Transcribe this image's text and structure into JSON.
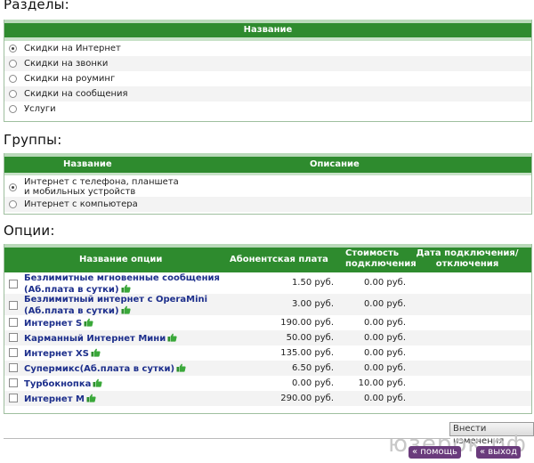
{
  "sections": {
    "heading": "Разделы:",
    "column": "Название",
    "items": [
      {
        "label": "Скидки на Интернет",
        "selected": true
      },
      {
        "label": "Скидки на звонки",
        "selected": false
      },
      {
        "label": "Скидки на роуминг",
        "selected": false
      },
      {
        "label": "Скидки на сообщения",
        "selected": false
      },
      {
        "label": "Услуги",
        "selected": false
      }
    ]
  },
  "groups": {
    "heading": "Группы:",
    "columns": [
      "Название",
      "Описание"
    ],
    "items": [
      {
        "label_line1": "Интернет с телефона, планшета",
        "label_line2": "и мобильных устройств",
        "selected": true
      },
      {
        "label_line1": "Интернет с компьютера",
        "label_line2": "",
        "selected": false
      }
    ]
  },
  "options": {
    "heading": "Опции:",
    "columns": {
      "name": "Название опции",
      "fee": "Абонентская плата",
      "cost_line1": "Стоимость",
      "cost_line2": "подключения",
      "date_line1": "Дата подключения/",
      "date_line2": "отключения"
    },
    "rows": [
      {
        "line1": "Безлимитные мгновенные сообщения",
        "line2": "(Аб.плата в сутки)",
        "fee": "1.50 руб.",
        "cost": "0.00 руб."
      },
      {
        "line1": "Безлимитный интернет с OperaMini",
        "line2": "(Аб.плата в сутки)",
        "fee": "3.00 руб.",
        "cost": "0.00 руб."
      },
      {
        "line1": "Интернет S",
        "line2": "",
        "fee": "190.00 руб.",
        "cost": "0.00 руб."
      },
      {
        "line1": "Карманный Интернет Мини",
        "line2": "",
        "fee": "50.00 руб.",
        "cost": "0.00 руб."
      },
      {
        "line1": "Интернет XS",
        "line2": "",
        "fee": "135.00 руб.",
        "cost": "0.00 руб."
      },
      {
        "line1": "Супермикс(Аб.плата в сутки)",
        "line2": "",
        "fee": "6.50 руб.",
        "cost": "0.00 руб."
      },
      {
        "line1": "Турбокнопка",
        "line2": "",
        "fee": "0.00 руб.",
        "cost": "10.00 руб."
      },
      {
        "line1": "Интернет M",
        "line2": "",
        "fee": "290.00 руб.",
        "cost": "0.00 руб."
      }
    ],
    "submit_label": "Внести изменения"
  },
  "watermark": {
    "text": "юзерок.рф",
    "help_label": "« помощь",
    "exit_label": "« выход"
  },
  "colors": {
    "header_green": "#2e8b2e",
    "link_blue": "#1d2f8c",
    "thumb_green": "#3aa83a"
  }
}
